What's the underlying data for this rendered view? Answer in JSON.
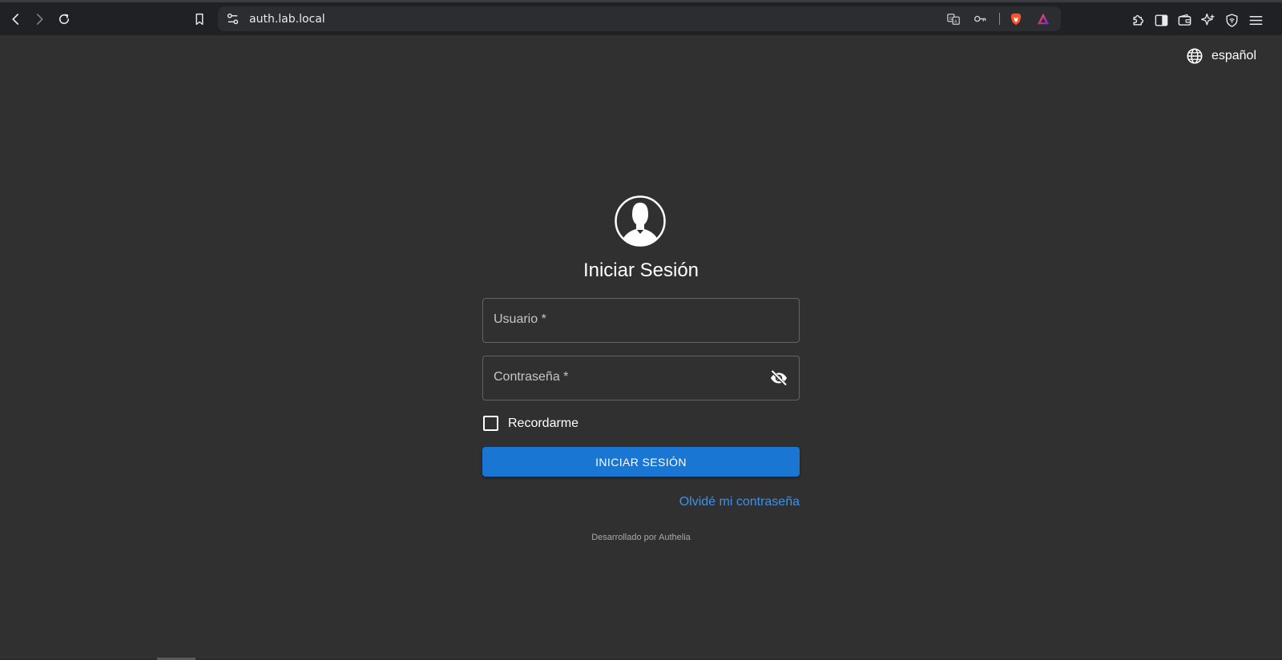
{
  "browser": {
    "url": "auth.lab.local",
    "icons": [
      "back-icon",
      "forward-icon",
      "reload-icon",
      "bookmark-icon",
      "site-settings-icon",
      "translate-icon",
      "key-icon",
      "brave-shield-icon",
      "brave-rewards-icon",
      "extensions-icon",
      "sidebar-icon",
      "wallet-icon",
      "leo-ai-icon",
      "vpn-icon",
      "menu-icon"
    ]
  },
  "language": {
    "label": "español",
    "icon": "globe-icon"
  },
  "login": {
    "avatar_icon": "user-avatar-icon",
    "title": "Iniciar Sesión",
    "username_label": "Usuario *",
    "password_label": "Contraseña *",
    "password_toggle_icon": "eye-off-icon",
    "remember_label": "Recordarme",
    "submit_label": "INICIAR SESIÓN",
    "forgot_label": "Olvidé mi contraseña",
    "powered_by": "Desarrollado por Authelia"
  },
  "colors": {
    "background": "#303030",
    "toolbar": "#202124",
    "primary_button": "#1976d2",
    "link": "#3f91e6"
  }
}
